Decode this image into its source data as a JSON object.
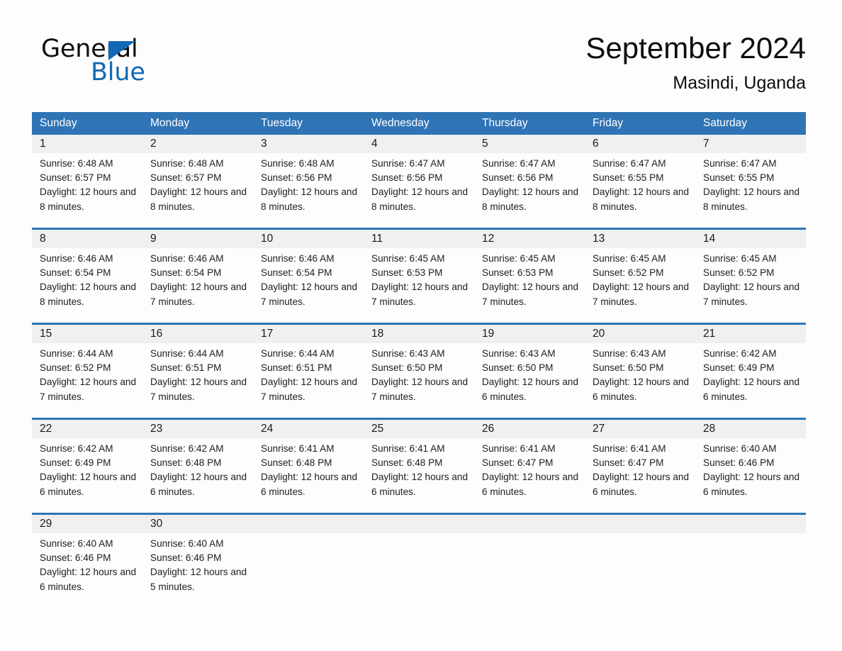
{
  "brand": {
    "name_part1": "General",
    "name_part2": "Blue",
    "flag_icon": "triangle-flag-icon",
    "accent_color": "#1268b3"
  },
  "header": {
    "title": "September 2024",
    "subtitle": "Masindi, Uganda"
  },
  "theme": {
    "header_blue": "#2f74b5",
    "daynum_band": "#f0f0f0",
    "page_background": "#fdfdfd",
    "text": "#1a1a1a"
  },
  "calendar": {
    "weekday_headers": [
      "Sunday",
      "Monday",
      "Tuesday",
      "Wednesday",
      "Thursday",
      "Friday",
      "Saturday"
    ],
    "labels": {
      "sunrise": "Sunrise:",
      "sunset": "Sunset:",
      "daylight": "Daylight:"
    },
    "weeks": [
      [
        {
          "day": "1",
          "sunrise": "Sunrise: 6:48 AM",
          "sunset": "Sunset: 6:57 PM",
          "daylight": "Daylight: 12 hours and 8 minutes."
        },
        {
          "day": "2",
          "sunrise": "Sunrise: 6:48 AM",
          "sunset": "Sunset: 6:57 PM",
          "daylight": "Daylight: 12 hours and 8 minutes."
        },
        {
          "day": "3",
          "sunrise": "Sunrise: 6:48 AM",
          "sunset": "Sunset: 6:56 PM",
          "daylight": "Daylight: 12 hours and 8 minutes."
        },
        {
          "day": "4",
          "sunrise": "Sunrise: 6:47 AM",
          "sunset": "Sunset: 6:56 PM",
          "daylight": "Daylight: 12 hours and 8 minutes."
        },
        {
          "day": "5",
          "sunrise": "Sunrise: 6:47 AM",
          "sunset": "Sunset: 6:56 PM",
          "daylight": "Daylight: 12 hours and 8 minutes."
        },
        {
          "day": "6",
          "sunrise": "Sunrise: 6:47 AM",
          "sunset": "Sunset: 6:55 PM",
          "daylight": "Daylight: 12 hours and 8 minutes."
        },
        {
          "day": "7",
          "sunrise": "Sunrise: 6:47 AM",
          "sunset": "Sunset: 6:55 PM",
          "daylight": "Daylight: 12 hours and 8 minutes."
        }
      ],
      [
        {
          "day": "8",
          "sunrise": "Sunrise: 6:46 AM",
          "sunset": "Sunset: 6:54 PM",
          "daylight": "Daylight: 12 hours and 8 minutes."
        },
        {
          "day": "9",
          "sunrise": "Sunrise: 6:46 AM",
          "sunset": "Sunset: 6:54 PM",
          "daylight": "Daylight: 12 hours and 7 minutes."
        },
        {
          "day": "10",
          "sunrise": "Sunrise: 6:46 AM",
          "sunset": "Sunset: 6:54 PM",
          "daylight": "Daylight: 12 hours and 7 minutes."
        },
        {
          "day": "11",
          "sunrise": "Sunrise: 6:45 AM",
          "sunset": "Sunset: 6:53 PM",
          "daylight": "Daylight: 12 hours and 7 minutes."
        },
        {
          "day": "12",
          "sunrise": "Sunrise: 6:45 AM",
          "sunset": "Sunset: 6:53 PM",
          "daylight": "Daylight: 12 hours and 7 minutes."
        },
        {
          "day": "13",
          "sunrise": "Sunrise: 6:45 AM",
          "sunset": "Sunset: 6:52 PM",
          "daylight": "Daylight: 12 hours and 7 minutes."
        },
        {
          "day": "14",
          "sunrise": "Sunrise: 6:45 AM",
          "sunset": "Sunset: 6:52 PM",
          "daylight": "Daylight: 12 hours and 7 minutes."
        }
      ],
      [
        {
          "day": "15",
          "sunrise": "Sunrise: 6:44 AM",
          "sunset": "Sunset: 6:52 PM",
          "daylight": "Daylight: 12 hours and 7 minutes."
        },
        {
          "day": "16",
          "sunrise": "Sunrise: 6:44 AM",
          "sunset": "Sunset: 6:51 PM",
          "daylight": "Daylight: 12 hours and 7 minutes."
        },
        {
          "day": "17",
          "sunrise": "Sunrise: 6:44 AM",
          "sunset": "Sunset: 6:51 PM",
          "daylight": "Daylight: 12 hours and 7 minutes."
        },
        {
          "day": "18",
          "sunrise": "Sunrise: 6:43 AM",
          "sunset": "Sunset: 6:50 PM",
          "daylight": "Daylight: 12 hours and 7 minutes."
        },
        {
          "day": "19",
          "sunrise": "Sunrise: 6:43 AM",
          "sunset": "Sunset: 6:50 PM",
          "daylight": "Daylight: 12 hours and 6 minutes."
        },
        {
          "day": "20",
          "sunrise": "Sunrise: 6:43 AM",
          "sunset": "Sunset: 6:50 PM",
          "daylight": "Daylight: 12 hours and 6 minutes."
        },
        {
          "day": "21",
          "sunrise": "Sunrise: 6:42 AM",
          "sunset": "Sunset: 6:49 PM",
          "daylight": "Daylight: 12 hours and 6 minutes."
        }
      ],
      [
        {
          "day": "22",
          "sunrise": "Sunrise: 6:42 AM",
          "sunset": "Sunset: 6:49 PM",
          "daylight": "Daylight: 12 hours and 6 minutes."
        },
        {
          "day": "23",
          "sunrise": "Sunrise: 6:42 AM",
          "sunset": "Sunset: 6:48 PM",
          "daylight": "Daylight: 12 hours and 6 minutes."
        },
        {
          "day": "24",
          "sunrise": "Sunrise: 6:41 AM",
          "sunset": "Sunset: 6:48 PM",
          "daylight": "Daylight: 12 hours and 6 minutes."
        },
        {
          "day": "25",
          "sunrise": "Sunrise: 6:41 AM",
          "sunset": "Sunset: 6:48 PM",
          "daylight": "Daylight: 12 hours and 6 minutes."
        },
        {
          "day": "26",
          "sunrise": "Sunrise: 6:41 AM",
          "sunset": "Sunset: 6:47 PM",
          "daylight": "Daylight: 12 hours and 6 minutes."
        },
        {
          "day": "27",
          "sunrise": "Sunrise: 6:41 AM",
          "sunset": "Sunset: 6:47 PM",
          "daylight": "Daylight: 12 hours and 6 minutes."
        },
        {
          "day": "28",
          "sunrise": "Sunrise: 6:40 AM",
          "sunset": "Sunset: 6:46 PM",
          "daylight": "Daylight: 12 hours and 6 minutes."
        }
      ],
      [
        {
          "day": "29",
          "sunrise": "Sunrise: 6:40 AM",
          "sunset": "Sunset: 6:46 PM",
          "daylight": "Daylight: 12 hours and 6 minutes."
        },
        {
          "day": "30",
          "sunrise": "Sunrise: 6:40 AM",
          "sunset": "Sunset: 6:46 PM",
          "daylight": "Daylight: 12 hours and 5 minutes."
        },
        {
          "day": "",
          "sunrise": "",
          "sunset": "",
          "daylight": ""
        },
        {
          "day": "",
          "sunrise": "",
          "sunset": "",
          "daylight": ""
        },
        {
          "day": "",
          "sunrise": "",
          "sunset": "",
          "daylight": ""
        },
        {
          "day": "",
          "sunrise": "",
          "sunset": "",
          "daylight": ""
        },
        {
          "day": "",
          "sunrise": "",
          "sunset": "",
          "daylight": ""
        }
      ]
    ]
  }
}
